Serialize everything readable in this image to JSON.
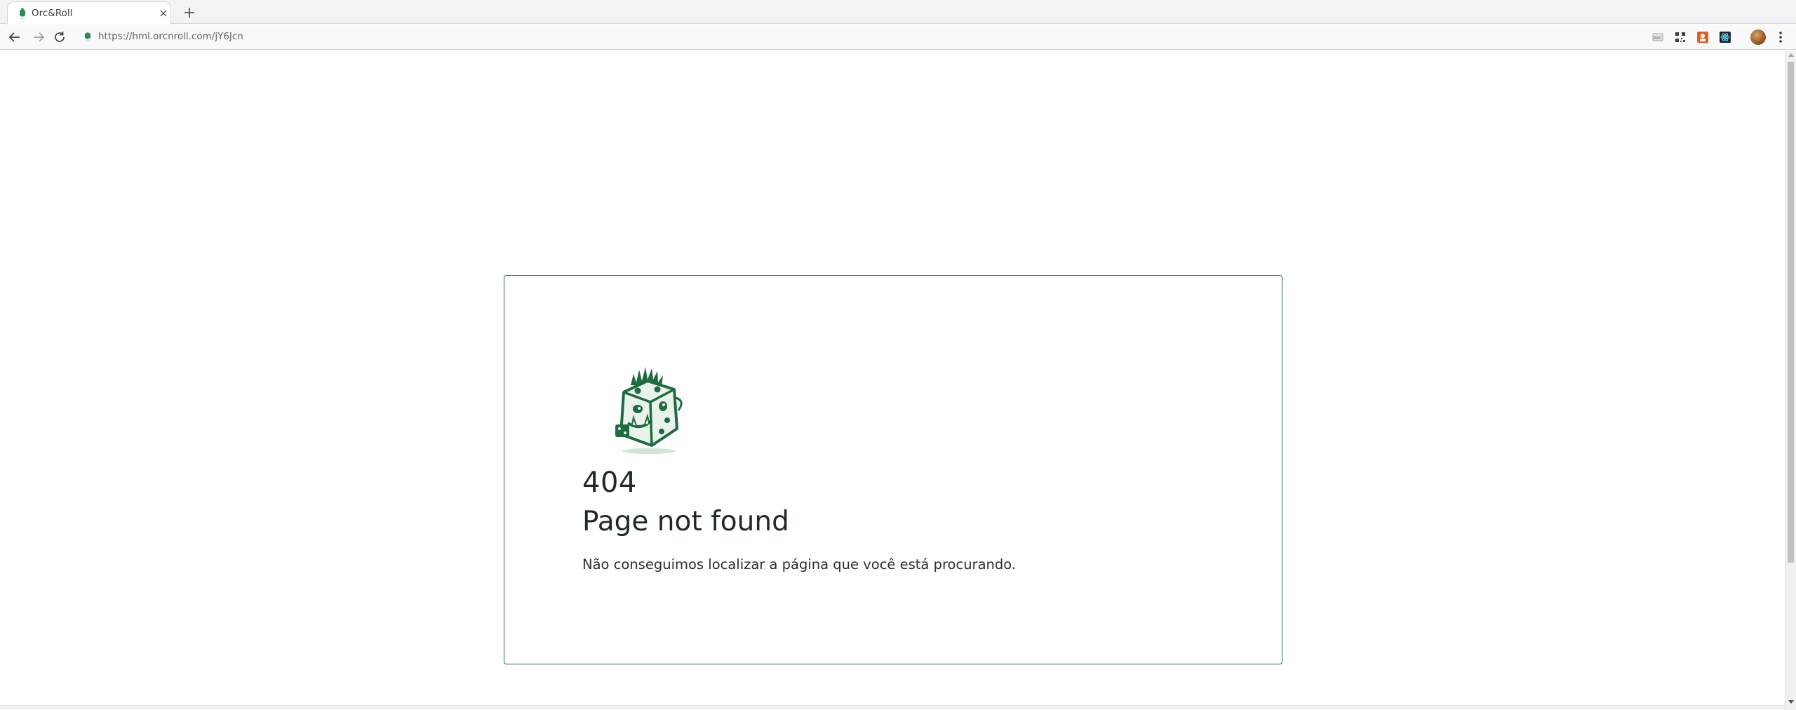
{
  "browser": {
    "tab": {
      "title": "Orc&Roll",
      "favicon": "orc-dice-favicon"
    },
    "url": "https://hml.orcnroll.com/jY6Jcn",
    "extensions": [
      "extension-icon",
      "qr-code-icon",
      "extension-icon",
      "extension-icon"
    ],
    "icons": {
      "back": "arrow-left-icon",
      "forward": "arrow-right-icon",
      "reload": "reload-icon",
      "new_tab": "plus-icon",
      "close_tab": "close-icon",
      "menu": "kebab-menu-icon"
    }
  },
  "page": {
    "error_code": "404",
    "title": "Page not found",
    "message": "Não conseguimos localizar a página que você está procurando.",
    "logo": "orc-dice-mascot"
  },
  "colors": {
    "brand_green": "#1f6b46",
    "text_dark": "#1d2b24"
  }
}
